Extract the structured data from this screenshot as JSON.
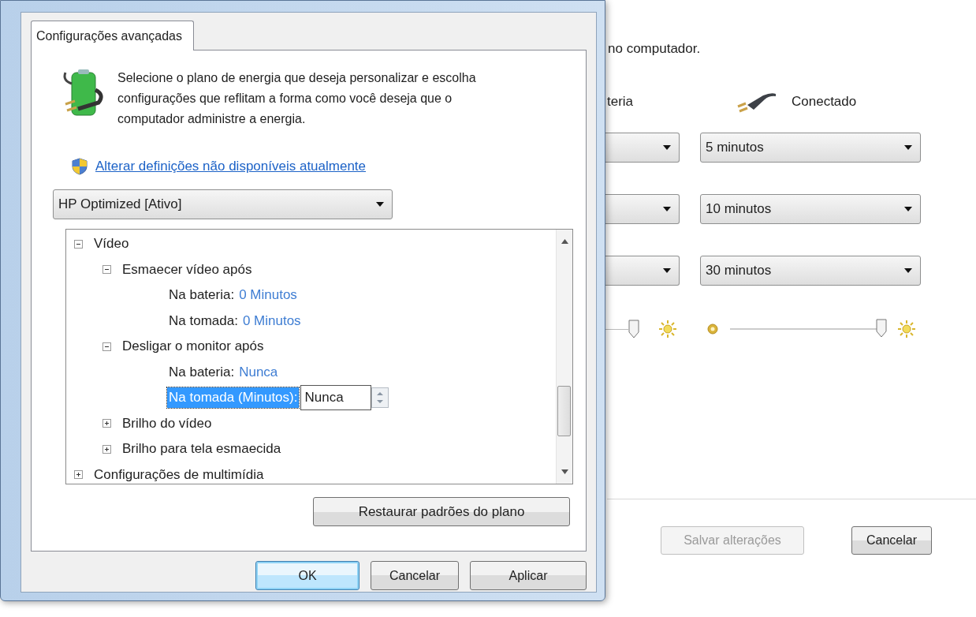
{
  "background_page": {
    "intro_tail": "no computador.",
    "battery_column": {
      "header_tail": "teria"
    },
    "plugged_column": {
      "header": "Conectado",
      "dropdowns": [
        "5 minutos",
        "10 minutos",
        "30 minutos"
      ],
      "brightness": {
        "level": 0.97
      }
    },
    "buttons": [
      {
        "label": "Salvar alterações",
        "disabled": true
      },
      {
        "label": "Cancelar",
        "disabled": false
      }
    ]
  },
  "dialog": {
    "tabs": [
      {
        "label": "Configurações avançadas",
        "selected": true
      }
    ],
    "description": "Selecione o plano de energia que deseja personalizar e escolha configurações que reflitam a forma como você deseja que o computador administre a energia.",
    "admin_link": "Alterar definições não disponíveis atualmente",
    "plan_dropdown": "HP Optimized [Ativo]",
    "tree": [
      {
        "label": "Vídeo",
        "expanded": true,
        "children": [
          {
            "label": "Esmaecer vídeo após",
            "expanded": true,
            "children": [
              {
                "label": "Na bateria:",
                "value": "0 Minutos",
                "selected": false
              },
              {
                "label": "Na tomada:",
                "value": "0 Minutos",
                "selected": false
              }
            ]
          },
          {
            "label": "Desligar o monitor após",
            "expanded": true,
            "children": [
              {
                "label": "Na bateria:",
                "value": "Nunca",
                "selected": false
              },
              {
                "label": "Na tomada (Minutos):",
                "value": "Nunca",
                "selected": true
              }
            ]
          },
          {
            "label": "Brilho do vídeo",
            "expanded": false
          },
          {
            "label": "Brilho para tela esmaecida",
            "expanded": false
          }
        ]
      },
      {
        "label": "Configurações de multimídia",
        "expanded": false
      }
    ],
    "restore_button": "Restaurar padrões do plano",
    "buttons": [
      {
        "label": "OK",
        "default": true
      },
      {
        "label": "Cancelar",
        "default": false
      },
      {
        "label": "Aplicar",
        "default": false
      }
    ]
  }
}
